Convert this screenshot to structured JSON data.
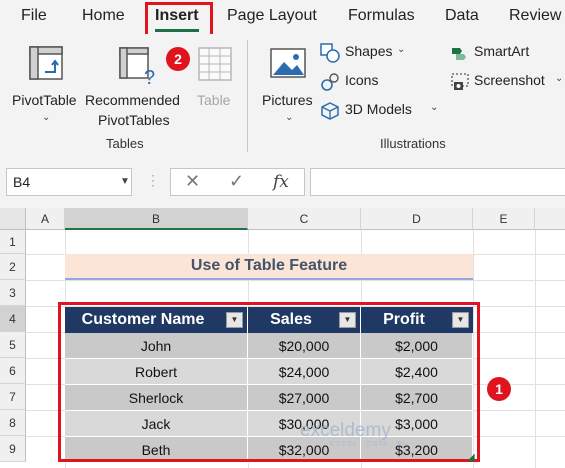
{
  "menu": {
    "items": [
      "File",
      "Home",
      "Insert",
      "Page Layout",
      "Formulas",
      "Data",
      "Review"
    ],
    "active": "Insert"
  },
  "ribbon": {
    "pivot_table": "PivotTable",
    "recommended_line1": "Recommended",
    "recommended_line2": "PivotTables",
    "table": "Table",
    "tables_group": "Tables",
    "pictures": "Pictures",
    "shapes": "Shapes",
    "icons": "Icons",
    "models_3d": "3D Models",
    "smartart": "SmartArt",
    "screenshot": "Screenshot",
    "illustrations_group": "Illustrations"
  },
  "badges": {
    "insert_step": "2",
    "table_step": "1"
  },
  "formula_bar": {
    "name_box": "B4",
    "fx": "fx",
    "formula": ""
  },
  "grid": {
    "columns": [
      "A",
      "B",
      "C",
      "D",
      "E"
    ],
    "rows": [
      "1",
      "2",
      "3",
      "4",
      "5",
      "6",
      "7",
      "8",
      "9"
    ]
  },
  "sheet": {
    "title": "Use of Table Feature",
    "headers": [
      "Customer Name",
      "Sales",
      "Profit"
    ],
    "rows": [
      [
        "John",
        "$20,000",
        "$2,000"
      ],
      [
        "Robert",
        "$24,000",
        "$2,400"
      ],
      [
        "Sherlock",
        "$27,000",
        "$2,700"
      ],
      [
        "Jack",
        "$30,000",
        "$3,000"
      ],
      [
        "Beth",
        "$32,000",
        "$3,200"
      ]
    ]
  },
  "watermark": {
    "name": "exceldemy",
    "tagline": "EXCEL · DATA · BI"
  },
  "colors": {
    "accent_green": "#1e7145",
    "highlight_red": "#e0141e",
    "table_header": "#1f3864",
    "title_fill": "#fbe5d6"
  }
}
